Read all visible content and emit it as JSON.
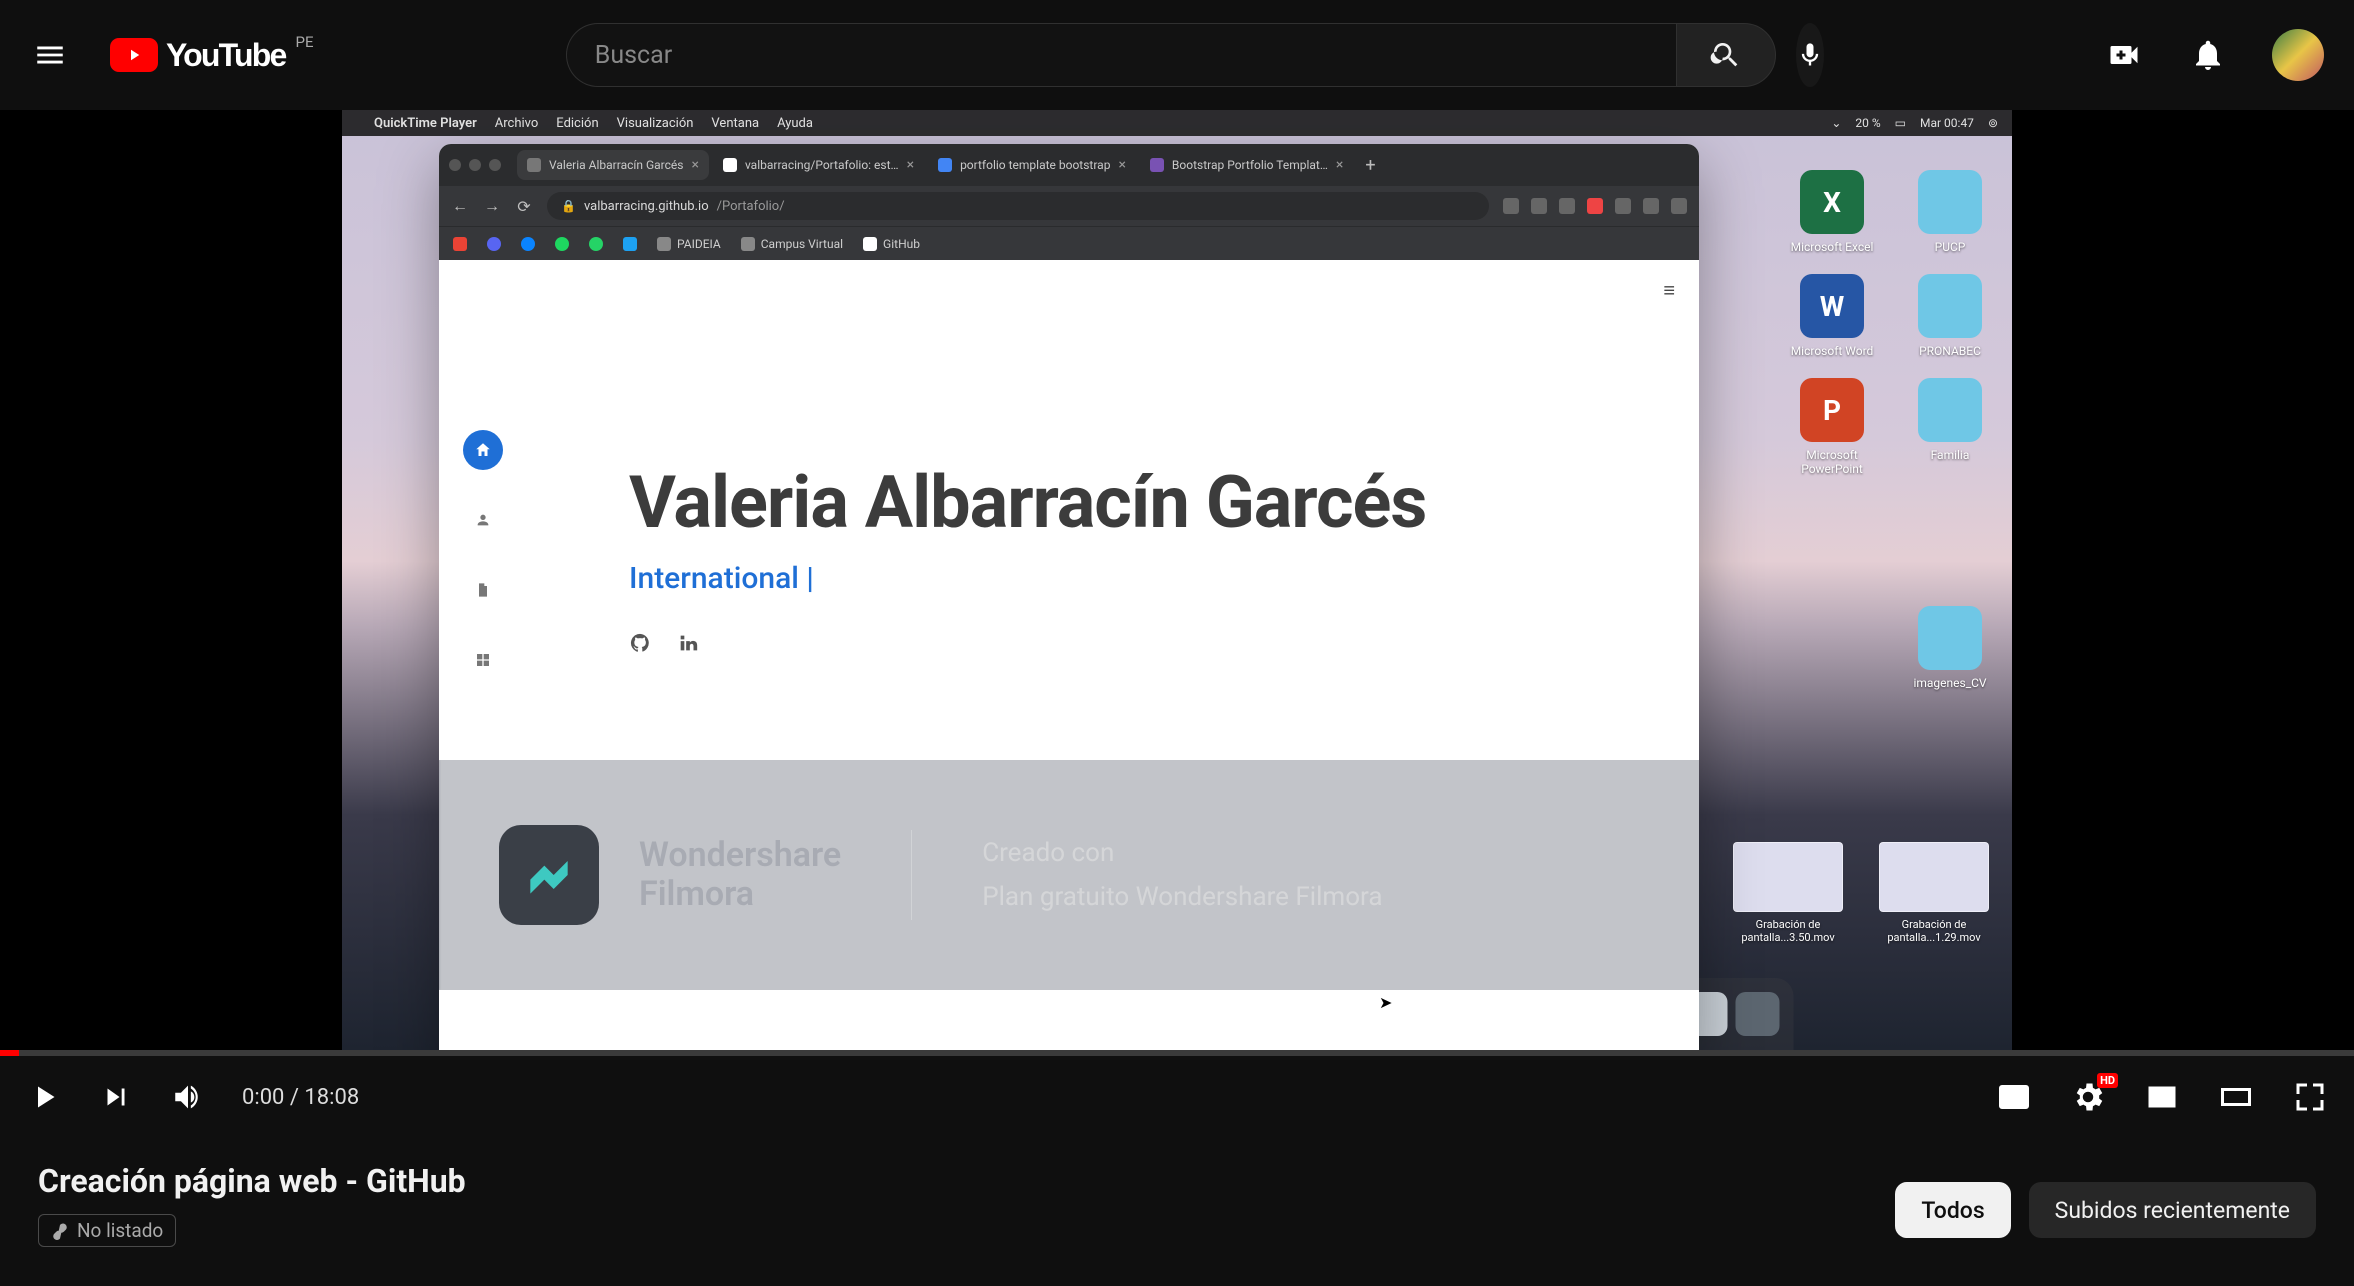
{
  "header": {
    "country": "PE",
    "logo_text": "YouTube",
    "search_placeholder": "Buscar"
  },
  "player": {
    "time_current": "0:00",
    "time_total": "18:08"
  },
  "video": {
    "title": "Creación página web - GitHub",
    "privacy": "No listado"
  },
  "filters": {
    "all": "Todos",
    "recent": "Subidos recientemente"
  },
  "mac": {
    "app": "QuickTime Player",
    "menus": [
      "Archivo",
      "Edición",
      "Visualización",
      "Ventana",
      "Ayuda"
    ],
    "battery": "20 %",
    "datetime": "Mar 00:47"
  },
  "browser": {
    "tabs": [
      "Valeria Albarracín Garcés",
      "valbarracing/Portafolio: est…",
      "portfolio template bootstrap",
      "Bootstrap Portfolio Templat…"
    ],
    "url_host": "valbarracing.github.io",
    "url_path": "/Portafolio/",
    "bookmarks": {
      "paideia": "PAIDEIA",
      "campus": "Campus Virtual",
      "github": "GitHub"
    }
  },
  "page": {
    "name": "Valeria Albarracín Garcés",
    "subtitle": "International |"
  },
  "filmora": {
    "brand1": "Wondershare",
    "brand2": "Filmora",
    "created": "Creado con",
    "plan": "Plan gratuito Wondershare Filmora"
  },
  "desktop_icons": {
    "excel": "Microsoft Excel",
    "pucp": "PUCP",
    "word": "Microsoft Word",
    "pronabec": "PRONABEC",
    "ppt": "Microsoft PowerPoint",
    "familia": "Familia",
    "imagenes": "imagenes_CV",
    "rec1a": "Grabación de",
    "rec1b": "pantalla...3.50.mov",
    "rec2a": "Grabación de",
    "rec2b": "pantalla...1.29.mov"
  }
}
